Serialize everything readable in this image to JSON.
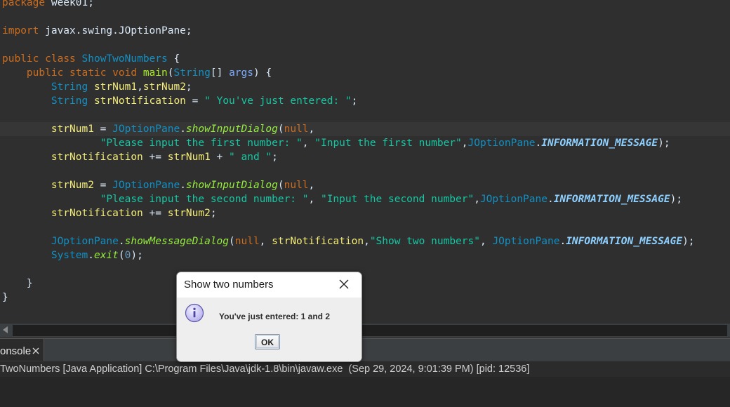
{
  "editor": {
    "lines": [
      [
        [
          "kw",
          "package"
        ],
        [
          "pln",
          " week01;"
        ]
      ],
      [],
      [
        [
          "kw",
          "import"
        ],
        [
          "pln",
          " javax.swing.JOptionPane;"
        ]
      ],
      [],
      [
        [
          "kw",
          "public"
        ],
        [
          "pln",
          " "
        ],
        [
          "kw",
          "class"
        ],
        [
          "pln",
          " "
        ],
        [
          "cls",
          "ShowTwoNumbers"
        ],
        [
          "pln",
          " {"
        ]
      ],
      [
        [
          "pln",
          "    "
        ],
        [
          "kw",
          "public"
        ],
        [
          "pln",
          " "
        ],
        [
          "kw",
          "static"
        ],
        [
          "pln",
          " "
        ],
        [
          "kw",
          "void"
        ],
        [
          "pln",
          " "
        ],
        [
          "mth",
          "main"
        ],
        [
          "pln",
          "("
        ],
        [
          "cls",
          "String"
        ],
        [
          "pln",
          "[] "
        ],
        [
          "param",
          "args"
        ],
        [
          "pln",
          ") {"
        ]
      ],
      [
        [
          "pln",
          "        "
        ],
        [
          "cls",
          "String"
        ],
        [
          "pln",
          " "
        ],
        [
          "var",
          "strNum1"
        ],
        [
          "pln",
          ","
        ],
        [
          "var",
          "strNum2"
        ],
        [
          "pln",
          ";"
        ]
      ],
      [
        [
          "pln",
          "        "
        ],
        [
          "cls",
          "String"
        ],
        [
          "pln",
          " "
        ],
        [
          "var",
          "strNotification"
        ],
        [
          "pln",
          " = "
        ],
        [
          "str",
          "\" You've just entered: \""
        ],
        [
          "pln",
          ";"
        ]
      ],
      [],
      [
        [
          "pln",
          "        "
        ],
        [
          "var",
          "strNum1"
        ],
        [
          "pln",
          " = "
        ],
        [
          "cls",
          "JOptionPane"
        ],
        [
          "pln",
          "."
        ],
        [
          "smth",
          "showInputDialog"
        ],
        [
          "pln",
          "("
        ],
        [
          "lit",
          "null"
        ],
        [
          "pln",
          ","
        ]
      ],
      [
        [
          "pln",
          "                "
        ],
        [
          "str",
          "\"Please input the first number: \""
        ],
        [
          "pln",
          ", "
        ],
        [
          "str",
          "\"Input the first number\""
        ],
        [
          "pln",
          ","
        ],
        [
          "cls",
          "JOptionPane"
        ],
        [
          "pln",
          "."
        ],
        [
          "cst",
          "INFORMATION_MESSAGE"
        ],
        [
          "pln",
          ");"
        ]
      ],
      [
        [
          "pln",
          "        "
        ],
        [
          "var",
          "strNotification"
        ],
        [
          "pln",
          " += "
        ],
        [
          "var",
          "strNum1"
        ],
        [
          "pln",
          " + "
        ],
        [
          "str",
          "\" and \""
        ],
        [
          "pln",
          ";"
        ]
      ],
      [],
      [
        [
          "pln",
          "        "
        ],
        [
          "var",
          "strNum2"
        ],
        [
          "pln",
          " = "
        ],
        [
          "cls",
          "JOptionPane"
        ],
        [
          "pln",
          "."
        ],
        [
          "smth",
          "showInputDialog"
        ],
        [
          "pln",
          "("
        ],
        [
          "lit",
          "null"
        ],
        [
          "pln",
          ","
        ]
      ],
      [
        [
          "pln",
          "                "
        ],
        [
          "str",
          "\"Please input the second number: \""
        ],
        [
          "pln",
          ", "
        ],
        [
          "str",
          "\"Input the second number\""
        ],
        [
          "pln",
          ","
        ],
        [
          "cls",
          "JOptionPane"
        ],
        [
          "pln",
          "."
        ],
        [
          "cst",
          "INFORMATION_MESSAGE"
        ],
        [
          "pln",
          ");"
        ]
      ],
      [
        [
          "pln",
          "        "
        ],
        [
          "var",
          "strNotification"
        ],
        [
          "pln",
          " += "
        ],
        [
          "var",
          "strNum2"
        ],
        [
          "pln",
          ";"
        ]
      ],
      [],
      [
        [
          "pln",
          "        "
        ],
        [
          "cls",
          "JOptionPane"
        ],
        [
          "pln",
          "."
        ],
        [
          "smth",
          "showMessageDialog"
        ],
        [
          "pln",
          "("
        ],
        [
          "lit",
          "null"
        ],
        [
          "pln",
          ", "
        ],
        [
          "var",
          "strNotification"
        ],
        [
          "pln",
          ","
        ],
        [
          "str",
          "\"Show two numbers\""
        ],
        [
          "pln",
          ", "
        ],
        [
          "cls",
          "JOptionPane"
        ],
        [
          "pln",
          "."
        ],
        [
          "cst",
          "INFORMATION_MESSAGE"
        ],
        [
          "pln",
          ");"
        ]
      ],
      [
        [
          "pln",
          "        "
        ],
        [
          "cls",
          "System"
        ],
        [
          "pln",
          "."
        ],
        [
          "smth",
          "exit"
        ],
        [
          "pln",
          "("
        ],
        [
          "num",
          "0"
        ],
        [
          "pln",
          ");"
        ]
      ],
      [],
      [
        [
          "pln",
          "    }"
        ]
      ],
      [
        [
          "pln",
          "}"
        ]
      ]
    ]
  },
  "console": {
    "tab_label": "onsole",
    "tab_close_icon": "close-icon",
    "status_text": "TwoNumbers [Java Application] C:\\Program Files\\Java\\jdk-1.8\\bin\\javaw.exe  (Sep 29, 2024, 9:01:39 PM) [pid: 12536]"
  },
  "dialog": {
    "title": "Show two numbers",
    "close_icon": "close-icon",
    "icon": "info-icon",
    "message": "You've just entered: 1 and 2",
    "ok_label": "OK"
  }
}
